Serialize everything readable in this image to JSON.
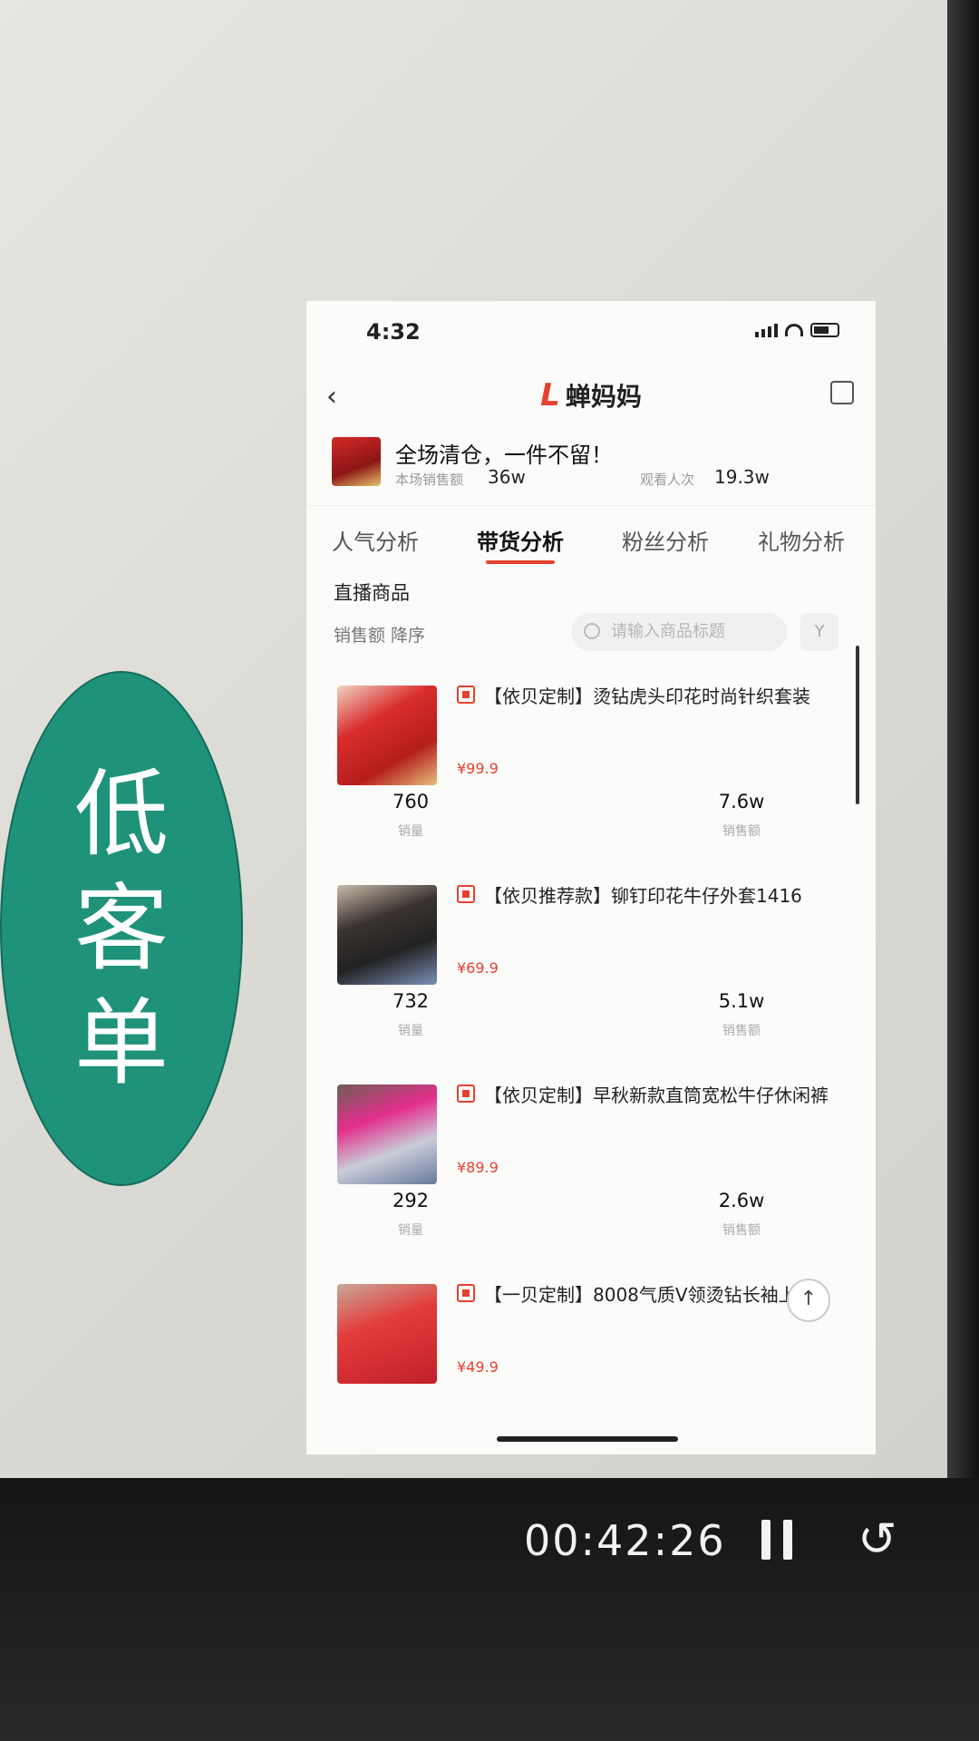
{
  "slide": {
    "oval_chars": [
      "低",
      "客",
      "单"
    ]
  },
  "phone": {
    "status_time": "4:32",
    "nav": {
      "back": "‹",
      "logo": "L",
      "brand": "蝉妈妈"
    },
    "live": {
      "title": "全场清仓，一件不留！",
      "metric1_label": "本场销售额",
      "metric1_value": "36w",
      "metric2_label": "观看人次",
      "metric2_value": "19.3w"
    },
    "tabs": [
      "人气分析",
      "带货分析",
      "粉丝分析",
      "礼物分析"
    ],
    "section_title": "直播商品",
    "sort_label": "销售额 降序",
    "search_placeholder": "请输入商品标题",
    "filter_icon": "Y",
    "products": [
      {
        "name": "【依贝定制】烫钻虎头印花时尚针织套装",
        "price": "¥99.9",
        "sales": "760",
        "sales_label": "销量",
        "amount": "7.6w",
        "amount_label": "销售额"
      },
      {
        "name": "【依贝推荐款】铆钉印花牛仔外套1416",
        "price": "¥69.9",
        "sales": "732",
        "sales_label": "销量",
        "amount": "5.1w",
        "amount_label": "销售额"
      },
      {
        "name": "【依贝定制】早秋新款直筒宽松牛仔休闲裤",
        "price": "¥89.9",
        "sales": "292",
        "sales_label": "销量",
        "amount": "2.6w",
        "amount_label": "销售额"
      },
      {
        "name": "【一贝定制】8008气质V领烫钻长袖上衣",
        "price": "¥49.9",
        "sales": "",
        "sales_label": "",
        "amount": "",
        "amount_label": ""
      }
    ],
    "totop_icon": "↑"
  },
  "player": {
    "time": "00:42:26",
    "replay_icon": "↺"
  }
}
